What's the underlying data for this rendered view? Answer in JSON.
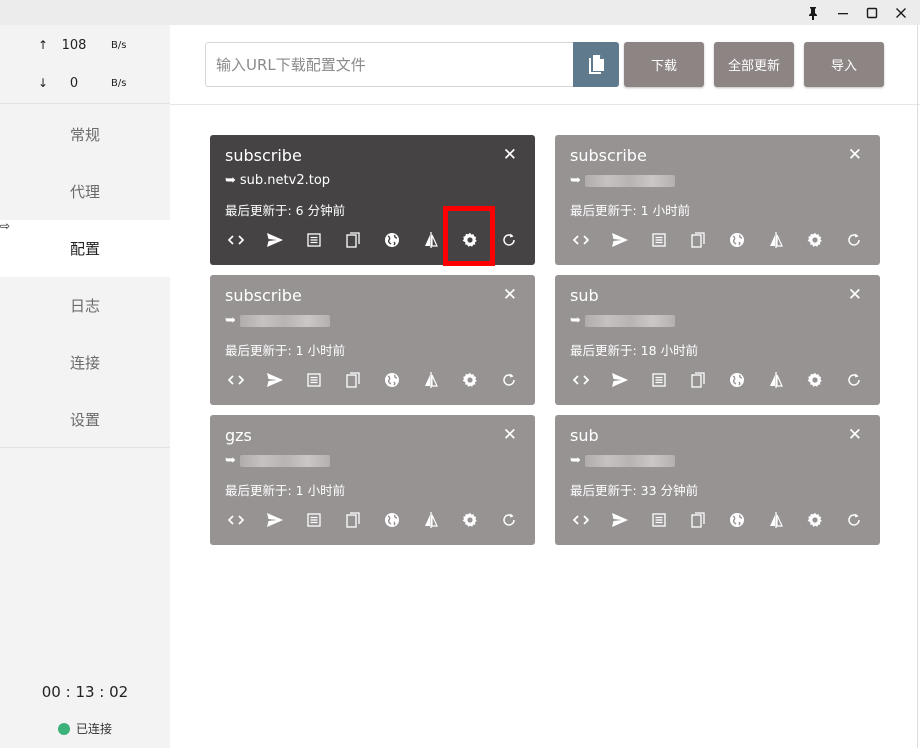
{
  "window": {
    "pin_icon": "pin-icon",
    "minimize_icon": "minimize-icon",
    "maximize_icon": "maximize-icon",
    "close_icon": "close-icon"
  },
  "traffic": {
    "up_arrow": "↑",
    "up_value": "108",
    "up_unit": "B/s",
    "down_arrow": "↓",
    "down_value": "0",
    "down_unit": "B/s"
  },
  "nav": {
    "items": [
      {
        "label": "常规"
      },
      {
        "label": "代理"
      },
      {
        "label": "配置",
        "active": true
      },
      {
        "label": "日志"
      },
      {
        "label": "连接"
      },
      {
        "label": "设置"
      }
    ],
    "active_marker": "⇨"
  },
  "footer": {
    "clock": "00 : 13 : 02",
    "status": "已连接",
    "status_color": "#3ab27a"
  },
  "toolbar": {
    "url_placeholder": "输入URL下载配置文件",
    "download_label": "下载",
    "update_all_label": "全部更新",
    "import_label": "导入",
    "paste_color": "#5f7a8c",
    "button_color": "#8c8584"
  },
  "profiles": [
    {
      "name": "subscribe",
      "url_prefix": "➥",
      "url": "sub.netv2.top",
      "updated": "最后更新于: 6 分钟前",
      "active": true
    },
    {
      "name": "subscribe",
      "url_prefix": "➥",
      "url": "",
      "updated": "最后更新于: 1 小时前",
      "active": false
    },
    {
      "name": "subscribe",
      "url_prefix": "➥",
      "url": "",
      "updated": "最后更新于: 1 小时前",
      "active": false
    },
    {
      "name": "sub",
      "url_prefix": "➥",
      "url": "",
      "updated": "最后更新于: 18 小时前",
      "active": false
    },
    {
      "name": "gzs",
      "url_prefix": "➥",
      "url": "",
      "updated": "最后更新于: 1 小时前",
      "active": false
    },
    {
      "name": "sub",
      "url_prefix": "➥",
      "url": "",
      "updated": "最后更新于: 33 分钟前",
      "active": false
    }
  ],
  "card_actions": [
    "code-icon",
    "send-icon",
    "list-icon",
    "copy-icon",
    "globe-icon",
    "split-icon",
    "gear-icon",
    "refresh-icon"
  ],
  "close_glyph": "✕",
  "colors": {
    "active_card": "#454343",
    "card": "#979393",
    "highlight": "#ff0000"
  }
}
